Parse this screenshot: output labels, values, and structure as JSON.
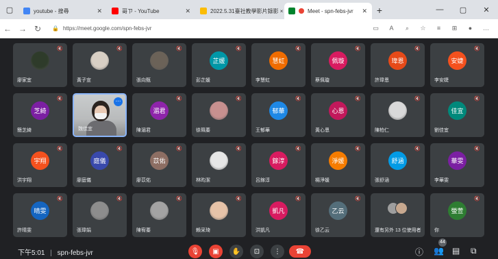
{
  "browser": {
    "tabs": [
      {
        "title": "youtube - 搜尋",
        "fav_color": "#4285f4"
      },
      {
        "title": "哥ㄗ - YouTube",
        "fav_color": "#ff0000"
      },
      {
        "title": "2022.5.31臺社教學影片錄影 ×",
        "fav_color": "#fbbc04"
      },
      {
        "title": "Meet - spn-febs-jvr",
        "fav_color": "#00832d"
      }
    ],
    "url": "https://meet.google.com/spn-febs-jvr"
  },
  "participants": [
    {
      "name": "廖家宜",
      "kind": "photo",
      "color": "#2e3b2a"
    },
    {
      "name": "黃子宣",
      "kind": "photo",
      "color": "#d8cfc4"
    },
    {
      "name": "張向甄",
      "kind": "photo",
      "color": "#6b6258"
    },
    {
      "name": "彭芷媛",
      "kind": "letter",
      "label": "芷媛",
      "color": "#0097a7"
    },
    {
      "name": "李慧虹",
      "kind": "letter",
      "label": "慧虹",
      "color": "#ef6c00"
    },
    {
      "name": "蔡佩璇",
      "kind": "letter",
      "label": "佩璇",
      "color": "#d81b60"
    },
    {
      "name": "許瑋恩",
      "kind": "letter",
      "label": "瑋恩",
      "color": "#e64a19"
    },
    {
      "name": "李安婕",
      "kind": "letter",
      "label": "安婕",
      "color": "#f4511e"
    },
    {
      "name": "簡芝綺",
      "kind": "letter",
      "label": "芝綺",
      "color": "#7b1fa2"
    },
    {
      "name": "魏佳宜",
      "kind": "self",
      "color": "#9a9d9e"
    },
    {
      "name": "陳湄君",
      "kind": "letter",
      "label": "湄君",
      "color": "#8e24aa"
    },
    {
      "name": "徐珮蓁",
      "kind": "photo",
      "color": "#c7908f"
    },
    {
      "name": "王郁華",
      "kind": "letter",
      "label": "郁華",
      "color": "#1e88e5"
    },
    {
      "name": "黃心恩",
      "kind": "letter",
      "label": "心恩",
      "color": "#c2185b"
    },
    {
      "name": "陳柏仁",
      "kind": "photo",
      "color": "#d9d9d9"
    },
    {
      "name": "劉佳宜",
      "kind": "letter",
      "label": "佳宜",
      "color": "#00897b"
    },
    {
      "name": "洪宇翔",
      "kind": "letter",
      "label": "宇翔",
      "color": "#f4511e"
    },
    {
      "name": "廖庭儀",
      "kind": "letter",
      "label": "庭儀",
      "color": "#3949ab"
    },
    {
      "name": "廖苡佑",
      "kind": "letter",
      "label": "苡佑",
      "color": "#8d6e63"
    },
    {
      "name": "林昀潔",
      "kind": "photo",
      "color": "#e6e6e6"
    },
    {
      "name": "呂鎵淳",
      "kind": "letter",
      "label": "鎵淳",
      "color": "#d81b60"
    },
    {
      "name": "楊淨媛",
      "kind": "letter",
      "label": "淨媛",
      "color": "#f57c00"
    },
    {
      "name": "張舒涵",
      "kind": "letter",
      "label": "舒涵",
      "color": "#039be5"
    },
    {
      "name": "李華雯",
      "kind": "letter",
      "label": "華雯",
      "color": "#7b1fa2"
    },
    {
      "name": "許晴雯",
      "kind": "letter",
      "label": "晴雯",
      "color": "#1565c0"
    },
    {
      "name": "張瑋娟",
      "kind": "photo",
      "color": "#8d8d8d"
    },
    {
      "name": "陳宥蓁",
      "kind": "photo",
      "color": "#a3a3a3"
    },
    {
      "name": "賴采琦",
      "kind": "photo",
      "color": "#e6c3a8"
    },
    {
      "name": "洪凱凡",
      "kind": "letter",
      "label": "凱凡",
      "color": "#d81b60"
    },
    {
      "name": "徐乙云",
      "kind": "letter",
      "label": "乙云",
      "color": "#546e7a"
    },
    {
      "name": "還有另外 13 位使用者",
      "kind": "others",
      "color": "#3c4043"
    },
    {
      "name": "你",
      "kind": "letter",
      "label": "螢萱",
      "color": "#2e7d32"
    }
  ],
  "bottom": {
    "time": "下午5:01",
    "separator": "|",
    "meeting_code": "spn-febs-jvr",
    "people_count": "44"
  }
}
